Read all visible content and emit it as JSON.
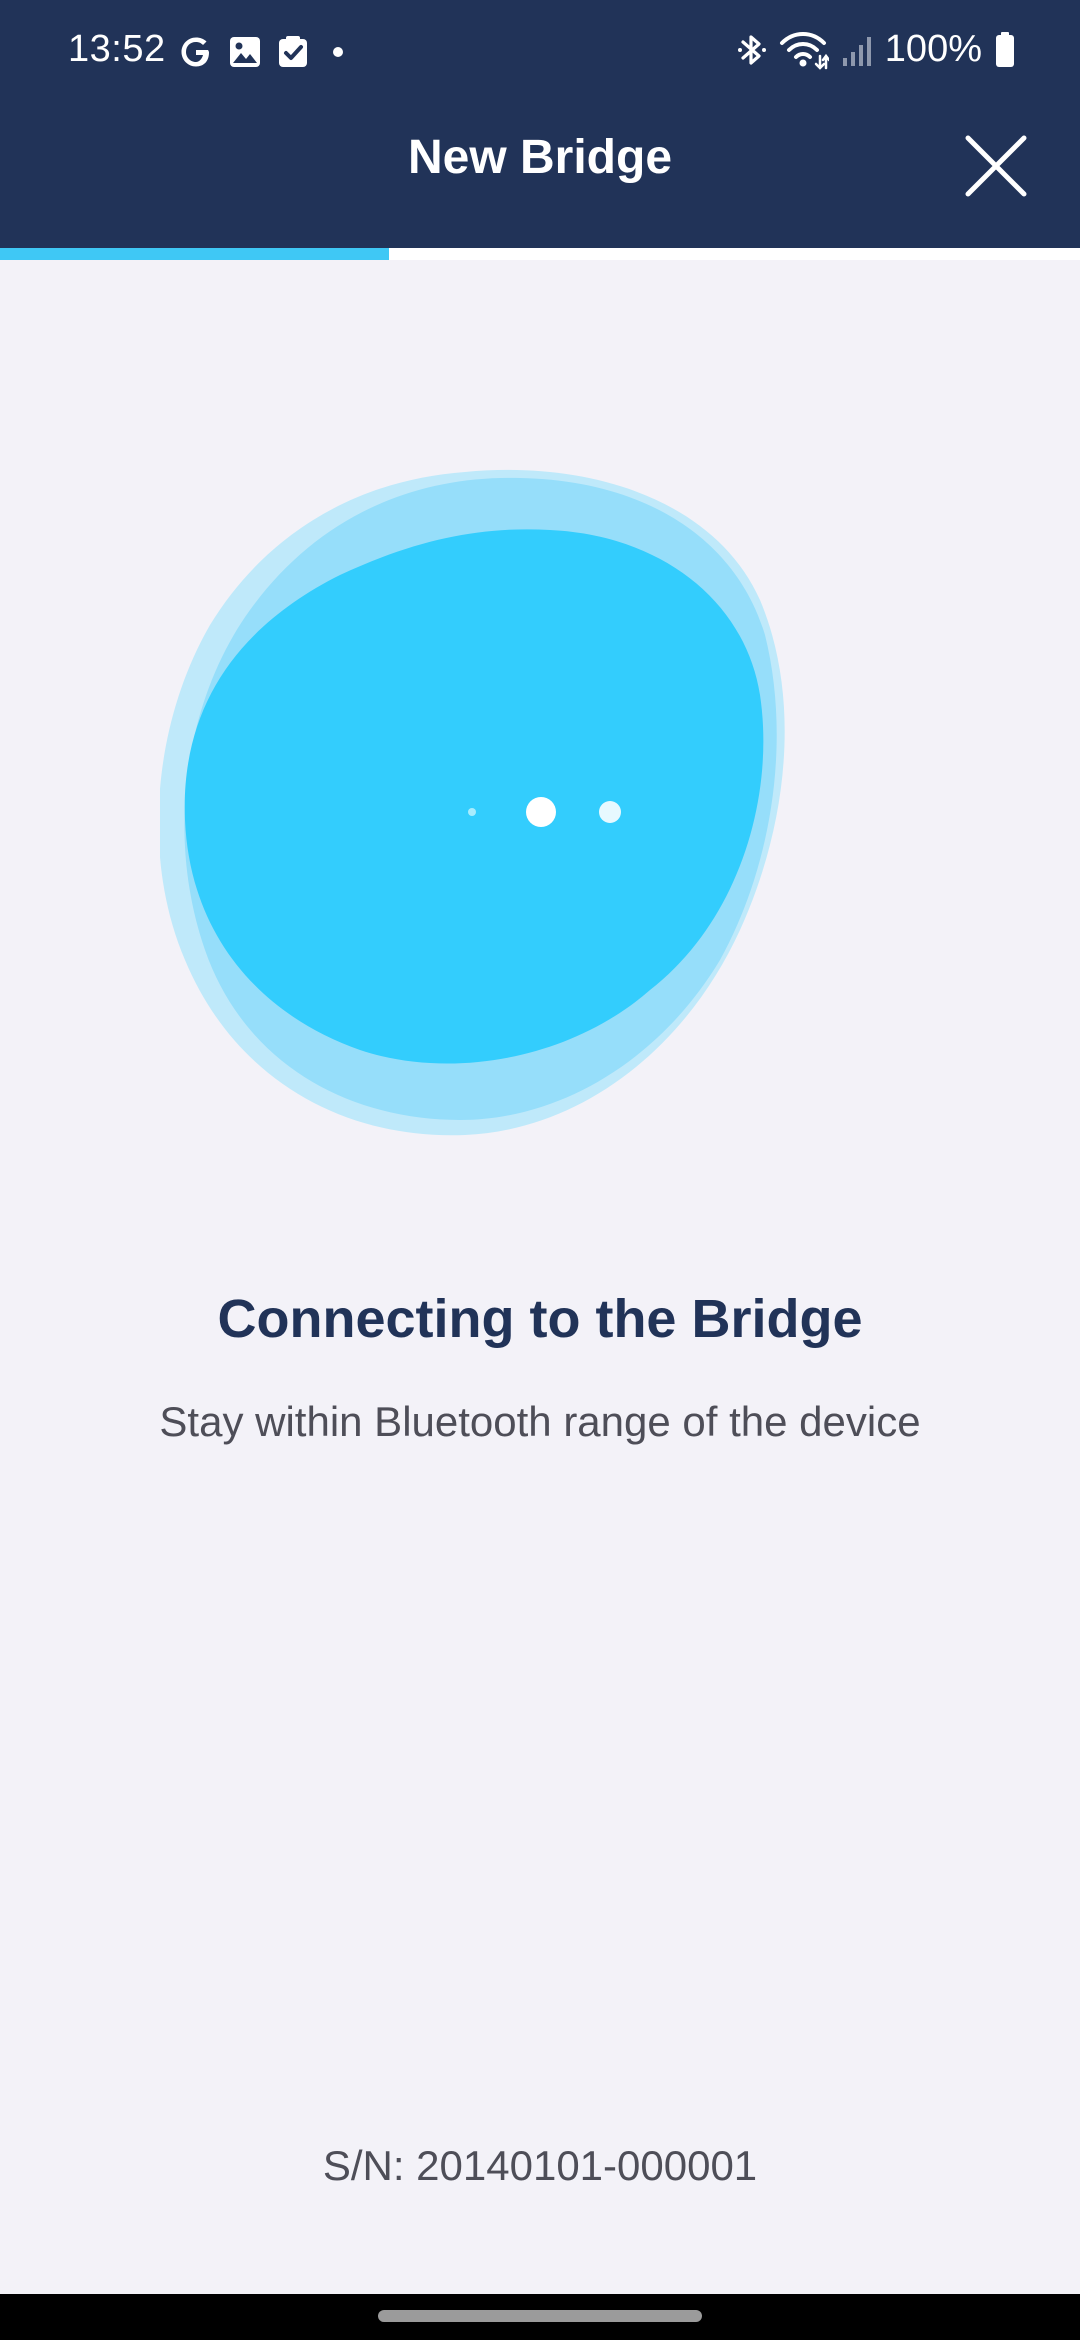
{
  "status_bar": {
    "time": "13:52",
    "left_icons": [
      "google-icon",
      "image-icon",
      "checkbox-icon",
      "dot-icon"
    ],
    "right_icons": [
      "bluetooth-icon",
      "wifi-icon",
      "signal-icon",
      "battery-icon"
    ],
    "battery": "100%"
  },
  "app_bar": {
    "title": "New Bridge",
    "close_icon": "close-icon"
  },
  "progress": {
    "fraction": 0.36,
    "color": "#3fc8f5"
  },
  "illustration": {
    "type": "blob-with-loading-dots",
    "colors": {
      "outer": "#bfe9fa",
      "middle": "#96defa",
      "inner": "#33cdfd",
      "dots": "#ffffff"
    }
  },
  "main": {
    "title": "Connecting to the Bridge",
    "subtitle": "Stay within Bluetooth range of the device"
  },
  "footer": {
    "serial": "S/N: 20140101-000001"
  },
  "colors": {
    "header_bg": "#213358",
    "page_bg": "#f3f2f8",
    "title_text": "#213358",
    "body_text": "#4e4e58"
  }
}
